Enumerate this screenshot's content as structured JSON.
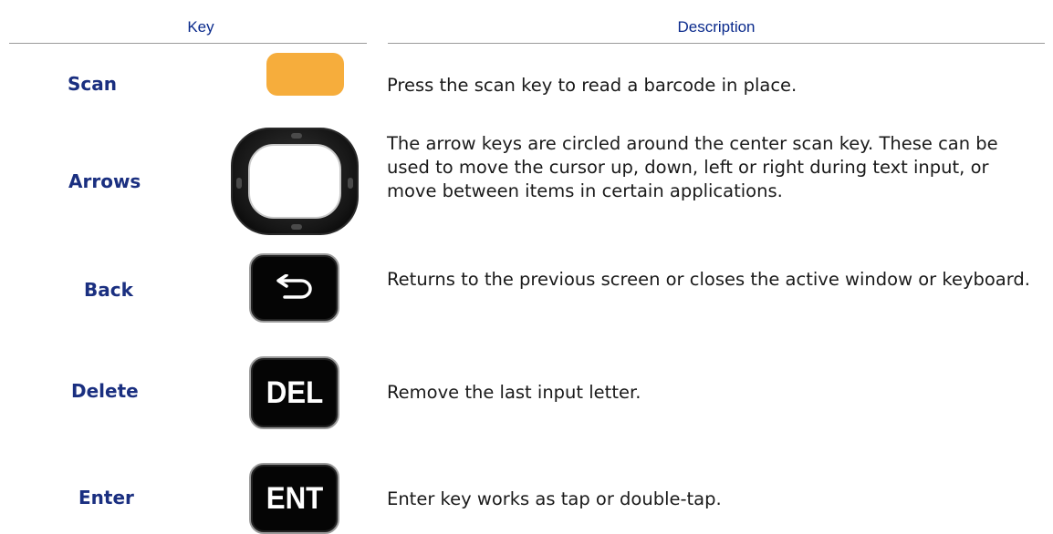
{
  "table": {
    "headers": {
      "key": "Key",
      "description": "Description"
    },
    "rows": [
      {
        "name": "Scan",
        "description": "Press the scan key to read a barcode in place.",
        "icon": "scan-key-icon",
        "color": "#F6AD3C"
      },
      {
        "name": "Arrows",
        "description": "The arrow keys are circled around the center scan key. These can be used to move the cursor up, down, left or right during text input, or move between items in certain applications.",
        "icon": "arrow-keys-ring-icon"
      },
      {
        "name": "Back",
        "description": "Returns to the previous screen or closes the active window or keyboard.",
        "icon": "back-arrow-key-icon"
      },
      {
        "name": "Delete",
        "description": "Remove the last input letter.",
        "icon": "delete-key-icon",
        "key_text": "DEL"
      },
      {
        "name": "Enter",
        "description": "Enter key works as tap or double-tap.",
        "icon": "enter-key-icon",
        "key_text": "ENT"
      }
    ]
  }
}
